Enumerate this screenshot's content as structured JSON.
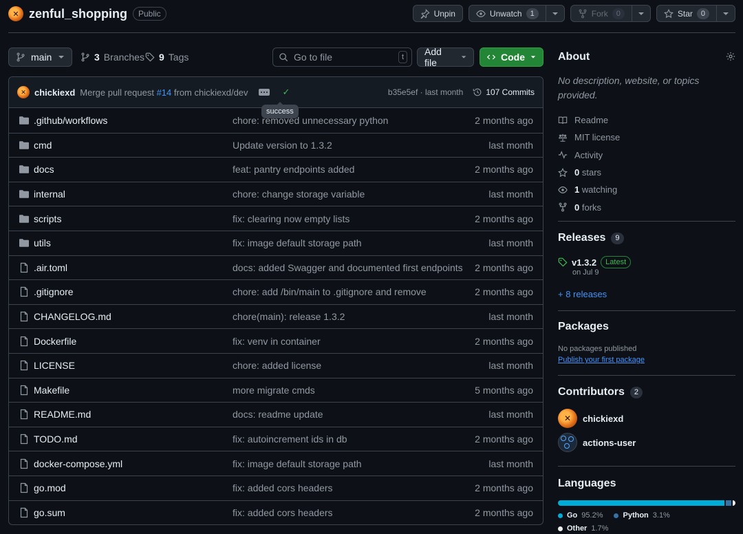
{
  "repo": {
    "name": "zenful_shopping",
    "visibility": "Public"
  },
  "header_actions": {
    "unpin": "Unpin",
    "unwatch": "Unwatch",
    "watch_count": "1",
    "fork": "Fork",
    "fork_count": "0",
    "star": "Star",
    "star_count": "0"
  },
  "toolbar": {
    "branch": "main",
    "branches_count": "3",
    "branches_label": "Branches",
    "tags_count": "9",
    "tags_label": "Tags",
    "goto_placeholder": "Go to file",
    "goto_kbd": "t",
    "add_file": "Add file",
    "code": "Code"
  },
  "commit": {
    "author": "chickiexd",
    "message_prefix": "Merge pull request",
    "pr": "#14",
    "message_suffix": "from chickiexd/dev",
    "tooltip": "success",
    "hash_time": "b35e5ef · last month",
    "commits": "107 Commits"
  },
  "files": [
    {
      "name": ".github/workflows",
      "type": "folder",
      "msg": "chore: removed unnecessary python",
      "when": "2 months ago"
    },
    {
      "name": "cmd",
      "type": "folder",
      "msg": "Update version to 1.3.2",
      "when": "last month"
    },
    {
      "name": "docs",
      "type": "folder",
      "msg": "feat: pantry endpoints added",
      "when": "2 months ago"
    },
    {
      "name": "internal",
      "type": "folder",
      "msg": "chore: change storage variable",
      "when": "last month"
    },
    {
      "name": "scripts",
      "type": "folder",
      "msg": "fix: clearing now empty lists",
      "when": "2 months ago"
    },
    {
      "name": "utils",
      "type": "folder",
      "msg": "fix: image default storage path",
      "when": "last month"
    },
    {
      "name": ".air.toml",
      "type": "file",
      "msg": "docs: added Swagger and documented first endpoints",
      "when": "2 months ago"
    },
    {
      "name": ".gitignore",
      "type": "file",
      "msg": "chore: add /bin/main to .gitignore and remove",
      "when": "2 months ago"
    },
    {
      "name": "CHANGELOG.md",
      "type": "file",
      "msg": "chore(main): release 1.3.2",
      "when": "last month"
    },
    {
      "name": "Dockerfile",
      "type": "file",
      "msg": "fix: venv in container",
      "when": "2 months ago"
    },
    {
      "name": "LICENSE",
      "type": "file",
      "msg": "chore: added license",
      "when": "last month"
    },
    {
      "name": "Makefile",
      "type": "file",
      "msg": "more migrate cmds",
      "when": "5 months ago"
    },
    {
      "name": "README.md",
      "type": "file",
      "msg": "docs: readme update",
      "when": "last month"
    },
    {
      "name": "TODO.md",
      "type": "file",
      "msg": "fix: autoincrement ids in db",
      "when": "2 months ago"
    },
    {
      "name": "docker-compose.yml",
      "type": "file",
      "msg": "fix: image default storage path",
      "when": "last month"
    },
    {
      "name": "go.mod",
      "type": "file",
      "msg": "fix: added cors headers",
      "when": "2 months ago"
    },
    {
      "name": "go.sum",
      "type": "file",
      "msg": "fix: added cors headers",
      "when": "2 months ago"
    }
  ],
  "about": {
    "title": "About",
    "description": "No description, website, or topics provided.",
    "items": [
      {
        "icon": "book-icon",
        "label": "Readme",
        "count": ""
      },
      {
        "icon": "scale-icon",
        "label": "MIT license",
        "count": ""
      },
      {
        "icon": "pulse-icon",
        "label": "Activity",
        "count": ""
      },
      {
        "icon": "star-icon",
        "label": "stars",
        "count": "0"
      },
      {
        "icon": "eye-icon",
        "label": "watching",
        "count": "1"
      },
      {
        "icon": "fork-icon",
        "label": "forks",
        "count": "0"
      }
    ]
  },
  "releases": {
    "title": "Releases",
    "count": "9",
    "version": "v1.3.2",
    "latest": "Latest",
    "date": "on Jul 9",
    "more": "+ 8 releases"
  },
  "packages": {
    "title": "Packages",
    "none": "No packages published",
    "publish": "Publish your first package"
  },
  "contributors": {
    "title": "Contributors",
    "count": "2",
    "list": [
      {
        "name": "chickiexd"
      },
      {
        "name": "actions-user"
      }
    ]
  },
  "languages": {
    "title": "Languages",
    "list": [
      {
        "name": "Go",
        "percent": "95.2%",
        "value": 95.2,
        "color": "#00add8"
      },
      {
        "name": "Python",
        "percent": "3.1%",
        "value": 3.1,
        "color": "#3572a5"
      },
      {
        "name": "Other",
        "percent": "1.7%",
        "value": 1.7,
        "color": "#ededed"
      }
    ]
  },
  "colors": {
    "accent_green": "#238636",
    "link_blue": "#4493f8",
    "bg": "#0d1117"
  }
}
